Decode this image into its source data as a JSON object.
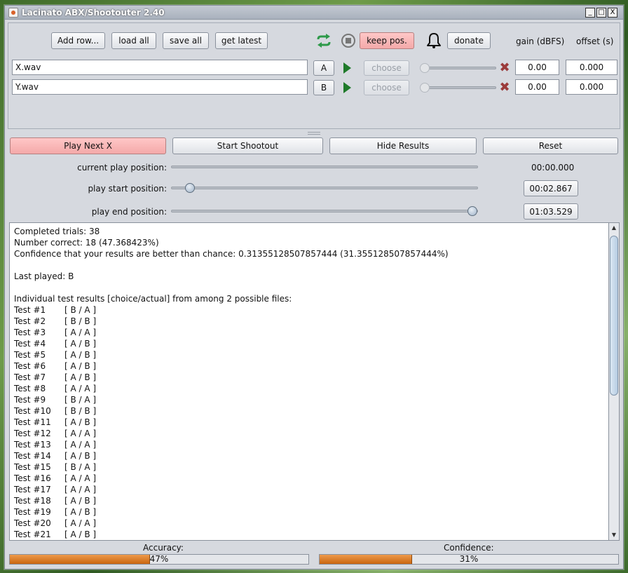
{
  "window": {
    "title": "Lacinato ABX/Shootouter 2.40",
    "controls": {
      "minimize": "_",
      "maximize": "□",
      "close": "X"
    }
  },
  "toolbar": {
    "add_row_label": "Add row...",
    "load_all_label": "load all",
    "save_all_label": "save all",
    "get_latest_label": "get latest",
    "keep_pos_label": "keep pos.",
    "donate_label": "donate",
    "gain_header": "gain (dBFS)",
    "offset_header": "offset (s)"
  },
  "file_rows": [
    {
      "file": "X.wav",
      "id_button": "A",
      "choose_label": "choose",
      "gain": "0.00",
      "offset": "0.000"
    },
    {
      "file": "Y.wav",
      "id_button": "B",
      "choose_label": "choose",
      "gain": "0.00",
      "offset": "0.000"
    }
  ],
  "actions": {
    "play_next": "Play Next X",
    "start_shootout": "Start Shootout",
    "hide_results": "Hide Results",
    "reset": "Reset"
  },
  "positions": {
    "current_label": "current play position:",
    "current_value": "00:00.000",
    "start_label": "play start position:",
    "start_value": "00:02.867",
    "end_label": "play end position:",
    "end_value": "01:03.529"
  },
  "results": {
    "completed": "Completed trials: 38",
    "correct": "Number correct: 18 (47.368423%)",
    "confidence": "Confidence that your results are better than chance: 0.31355128507857444 (31.355128507857444%)",
    "last_played": "Last played: B",
    "individual_header": "Individual test results [choice/actual] from among 2 possible files:",
    "tests": [
      {
        "name": "Test #1",
        "result": "[ B / A ]"
      },
      {
        "name": "Test #2",
        "result": "[ B / B ]"
      },
      {
        "name": "Test #3",
        "result": "[ A / A ]"
      },
      {
        "name": "Test #4",
        "result": "[ A / B ]"
      },
      {
        "name": "Test #5",
        "result": "[ A / B ]"
      },
      {
        "name": "Test #6",
        "result": "[ A / B ]"
      },
      {
        "name": "Test #7",
        "result": "[ A / B ]"
      },
      {
        "name": "Test #8",
        "result": "[ A / A ]"
      },
      {
        "name": "Test #9",
        "result": "[ B / A ]"
      },
      {
        "name": "Test #10",
        "result": "[ B / B ]"
      },
      {
        "name": "Test #11",
        "result": "[ A / B ]"
      },
      {
        "name": "Test #12",
        "result": "[ A / A ]"
      },
      {
        "name": "Test #13",
        "result": "[ A / A ]"
      },
      {
        "name": "Test #14",
        "result": "[ A / B ]"
      },
      {
        "name": "Test #15",
        "result": "[ B / A ]"
      },
      {
        "name": "Test #16",
        "result": "[ A / A ]"
      },
      {
        "name": "Test #17",
        "result": "[ A / A ]"
      },
      {
        "name": "Test #18",
        "result": "[ A / B ]"
      },
      {
        "name": "Test #19",
        "result": "[ A / B ]"
      },
      {
        "name": "Test #20",
        "result": "[ A / A ]"
      },
      {
        "name": "Test #21",
        "result": "[ A / B ]"
      }
    ]
  },
  "footer": {
    "accuracy_label": "Accuracy:",
    "accuracy_text": "47%",
    "accuracy_value": 0.47,
    "confidence_label": "Confidence:",
    "confidence_text": "31%",
    "confidence_value": 0.31
  },
  "colors": {
    "pink_button": "#f4a9a9",
    "progress_fill": "#d9741f",
    "play_icon": "#1f7a2a",
    "repeat_icon": "#2e9a4a",
    "remove_icon": "#9b3b3b"
  }
}
